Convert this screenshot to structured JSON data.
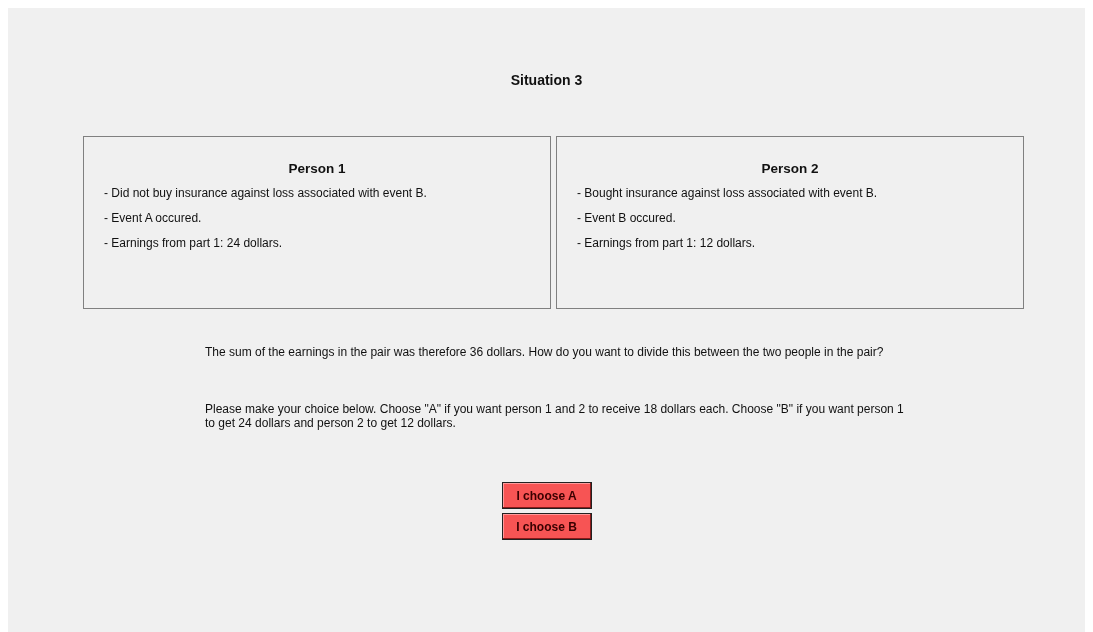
{
  "title": "Situation 3",
  "persons": [
    {
      "heading": "Person 1",
      "lines": [
        "- Did not buy insurance against loss associated with event B.",
        "- Event A occured.",
        "- Earnings from part 1: 24 dollars."
      ]
    },
    {
      "heading": "Person 2",
      "lines": [
        "- Bought insurance against loss associated with event B.",
        "- Event B occured.",
        "- Earnings from part 1: 12 dollars."
      ]
    }
  ],
  "paragraphs": [
    "The sum of the earnings in the pair was therefore 36 dollars. How do you want to divide this between the two people in the pair?",
    "Please make your choice below. Choose \"A\" if you want person 1 and 2 to receive 18 dollars each. Choose \"B\" if you want person 1 to get 24 dollars and person 2 to get 12 dollars."
  ],
  "buttons": [
    "I choose A",
    "I choose B"
  ]
}
